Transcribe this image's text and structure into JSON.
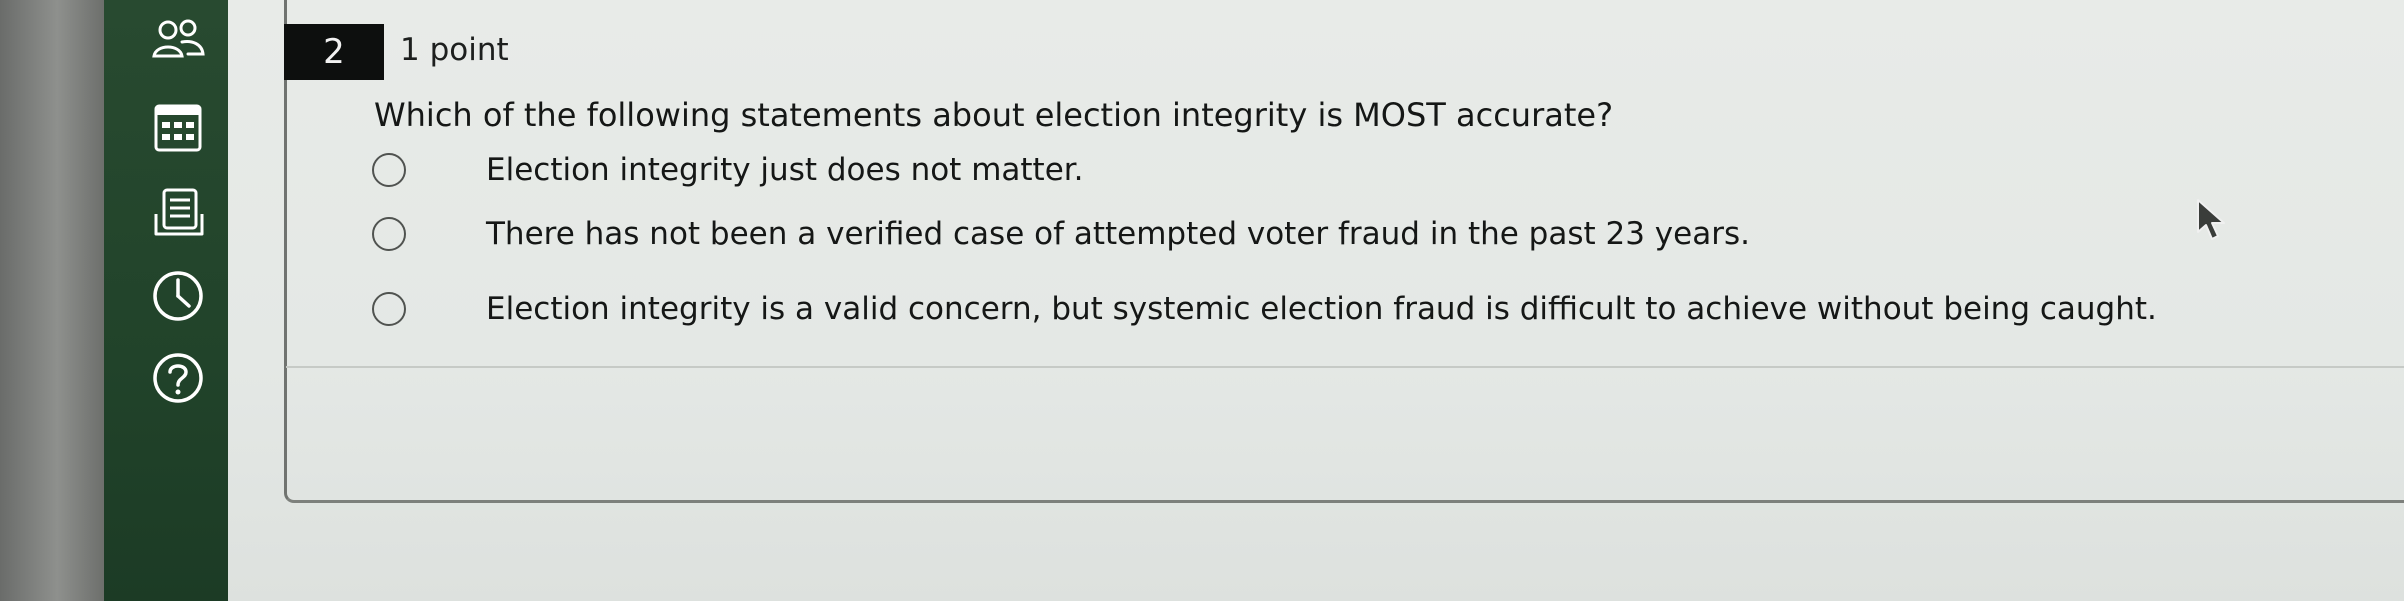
{
  "question": {
    "number": "2",
    "points": "1 point",
    "text": "Which of the following statements about election integrity is MOST accurate?",
    "options": [
      {
        "label": "Election integrity just does not matter."
      },
      {
        "label": "There has not been a verified case of attempted voter fraud in the past 23 years."
      },
      {
        "label": "Election integrity is a valid concern, but systemic election fraud is difficult to achieve without being caught."
      }
    ]
  },
  "sidebar": {
    "icons": [
      "people-icon",
      "calendar-icon",
      "notes-icon",
      "clock-icon",
      "help-icon"
    ]
  },
  "colors": {
    "sidebar": "#234530",
    "question_number_bg": "#0d0f0e",
    "page_bg": "#e6e9e6"
  }
}
